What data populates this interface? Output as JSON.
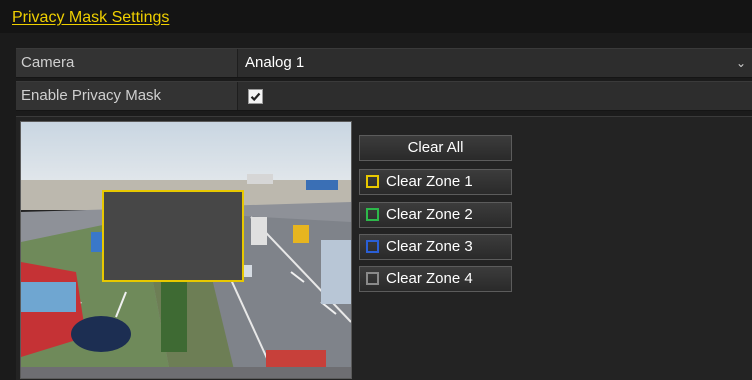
{
  "header": {
    "title": "Privacy Mask Settings"
  },
  "camera": {
    "label": "Camera",
    "value": "Analog 1"
  },
  "enable": {
    "label": "Enable Privacy Mask",
    "checked": true
  },
  "buttons": {
    "clear_all": "Clear All",
    "zones": [
      {
        "label": "Clear Zone 1",
        "color": "#e8c800"
      },
      {
        "label": "Clear Zone 2",
        "color": "#2db84a"
      },
      {
        "label": "Clear Zone 3",
        "color": "#2a5fd6"
      },
      {
        "label": "Clear Zone 4",
        "color": "#8a8a8a"
      }
    ]
  },
  "mask": {
    "color": "#e8c800"
  },
  "icons": {
    "dropdown": "chevron-down-icon",
    "checkbox": "checkmark-icon"
  }
}
